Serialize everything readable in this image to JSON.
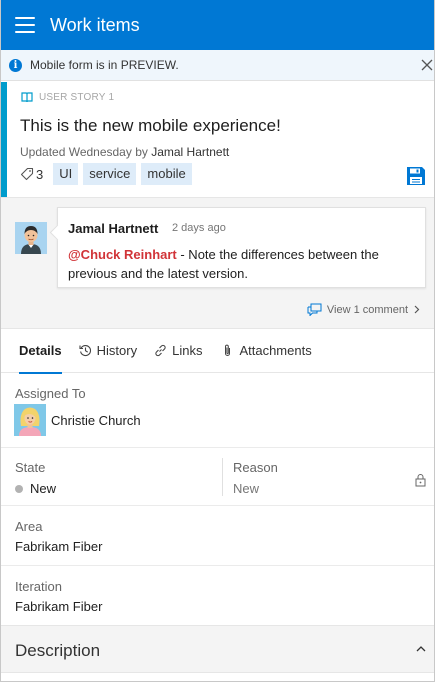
{
  "appbar": {
    "title": "Work items"
  },
  "banner": {
    "text": "Mobile form is in PREVIEW."
  },
  "work_item": {
    "type_label": "USER STORY 1",
    "title": "This is the new mobile experience!",
    "updated_prefix": "Updated Wednesday by ",
    "updated_by": "Jamal Hartnett",
    "tag_count": "3",
    "tags": [
      "UI",
      "service",
      "mobile"
    ],
    "accent_color": "#009ccc"
  },
  "discussion": {
    "author": "Jamal Hartnett",
    "time": "2 days ago",
    "mention": "@Chuck Reinhart",
    "body": " - Note the differences between the previous and the latest version.",
    "view_label": "View 1 comment"
  },
  "tabs": [
    {
      "label": "Details",
      "icon": ""
    },
    {
      "label": "History",
      "icon": "history-icon"
    },
    {
      "label": "Links",
      "icon": "link-icon"
    },
    {
      "label": "Attachments",
      "icon": "paperclip-icon"
    }
  ],
  "fields": {
    "assigned_label": "Assigned To",
    "assigned_value": "Christie Church",
    "state_label": "State",
    "state_value": "New",
    "reason_label": "Reason",
    "reason_value": "New",
    "area_label": "Area",
    "area_value": "Fabrikam Fiber",
    "iteration_label": "Iteration",
    "iteration_value": "Fabrikam Fiber"
  },
  "description": {
    "label": "Description"
  },
  "colors": {
    "brand": "#0078d4",
    "mention": "#d13438"
  }
}
